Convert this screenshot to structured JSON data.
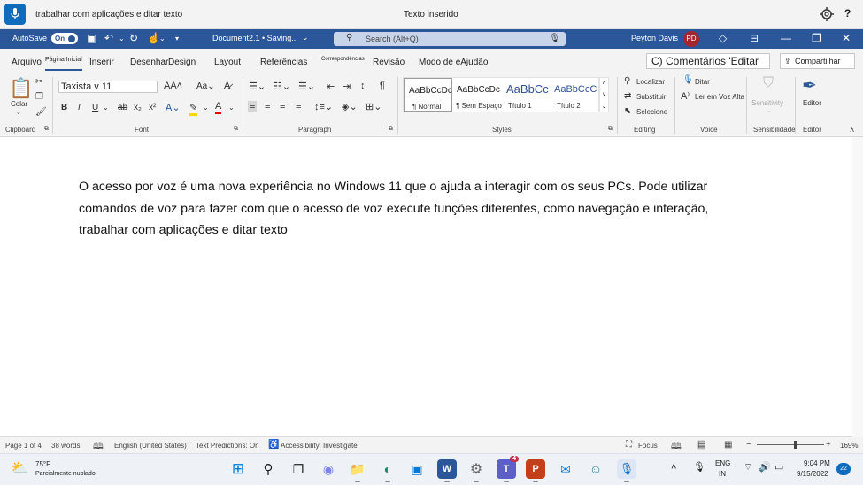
{
  "voice_access": {
    "recognized_text": "trabalhar com aplicações e ditar texto",
    "status": "Texto inserido"
  },
  "titlebar": {
    "autosave_label": "AutoSave",
    "autosave_state": "On",
    "document_name": "Document2.1 • Saving...",
    "search_placeholder": "Search (Alt+Q)",
    "user_name": "Peyton Davis",
    "user_initials": "PD"
  },
  "tabs": [
    {
      "label": "Arquivo"
    },
    {
      "label": "Página Inicial"
    },
    {
      "label": "Inserir"
    },
    {
      "label": "Desenhar"
    },
    {
      "label": "Design"
    },
    {
      "label": "Layout"
    },
    {
      "label": "Referências"
    },
    {
      "label": "Correspondências"
    },
    {
      "label": "Revisão"
    },
    {
      "label": "Modo de eAjudão"
    }
  ],
  "comments_button": "C) Comentários 'Editar",
  "share_button": "Compartilhar",
  "ribbon": {
    "clipboard": {
      "paste_label": "Colar",
      "group_label": "Clipboard"
    },
    "font": {
      "font_name": "Taxista v 11",
      "group_label": "Font"
    },
    "paragraph": {
      "group_label": "Paragraph"
    },
    "styles": {
      "group_label": "Styles",
      "items": [
        {
          "sample": "AaBbCcDc",
          "name": "¶ Normal"
        },
        {
          "sample": "AaBbCcDc",
          "name": "¶ Sem Espaço"
        },
        {
          "sample": "AaBbCc",
          "name": "Título 1"
        },
        {
          "sample": "AaBbCcC",
          "name": "Título 2"
        }
      ]
    },
    "editing": {
      "find": "Localizar",
      "replace": "Substituir",
      "select": "Selecione",
      "group_label": "Editing"
    },
    "voice": {
      "dictate": "Ditar",
      "read_aloud": "Ler em Voz Alta",
      "group_label": "Voice"
    },
    "sensitivity": {
      "button": "Sensitivity",
      "group_label": "Sensibilidade"
    },
    "editor": {
      "button": "Editor",
      "group_label": "Editor"
    }
  },
  "document": {
    "body": "O acesso por voz é uma nova experiência no Windows 11 que o ajuda a interagir com os seus PCs. Pode utilizar comandos de voz para fazer com que o acesso de voz execute funções diferentes, como navegação e interação, trabalhar com aplicações e ditar texto"
  },
  "statusbar": {
    "page": "Page 1 of 4",
    "words": "38 words",
    "language": "English (United States)",
    "predictions": "Text Predictions: On",
    "accessibility": "Accessibility: Investigate",
    "focus": "Focus",
    "zoom": "169%"
  },
  "taskbar": {
    "weather_temp": "75°F",
    "weather_desc": "Parcialmente nublado",
    "lang_line1": "ENG",
    "lang_line2": "IN",
    "time": "9:04 PM",
    "date": "9/15/2022",
    "notification_count": "22",
    "teams_badge": "4"
  },
  "colors": {
    "word_blue": "#2b579a",
    "voice_blue": "#0f6cbd"
  }
}
